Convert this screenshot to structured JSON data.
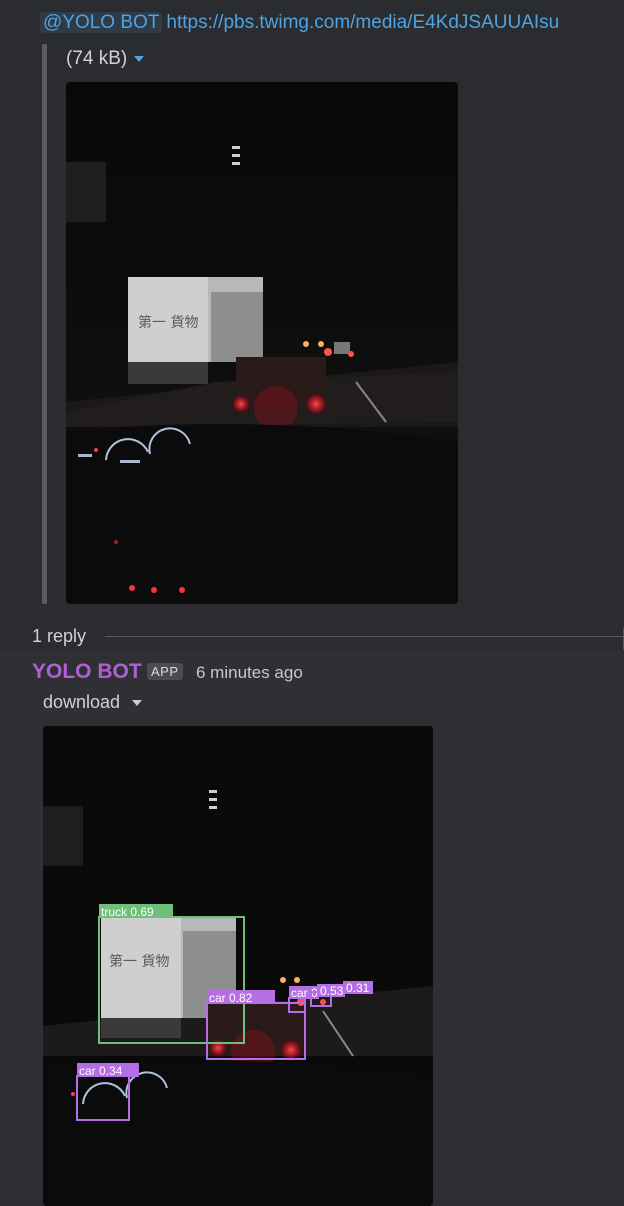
{
  "parent_message": {
    "mention": "@YOLO BOT",
    "link": "https://pbs.twimg.com/media/E4KdJSAUUAIsu",
    "file_size": "(74 kB)"
  },
  "thread": {
    "reply_count": "1 reply"
  },
  "reply_message": {
    "author": "YOLO BOT",
    "badge": "APP",
    "timestamp": "6 minutes ago",
    "file_name": "download",
    "detections": [
      {
        "label": "truck 0.69"
      },
      {
        "label": "car 0.82"
      },
      {
        "label": "car 0.5"
      },
      {
        "label": "0.53"
      },
      {
        "label": "0.31"
      },
      {
        "label": "car 0.34"
      }
    ]
  },
  "colors": {
    "background": "#2b2c30",
    "link": "#4ea3e0",
    "author": "#b25fd6",
    "truck_box": "#6fbf7a",
    "car_box": "#b56ee6"
  }
}
